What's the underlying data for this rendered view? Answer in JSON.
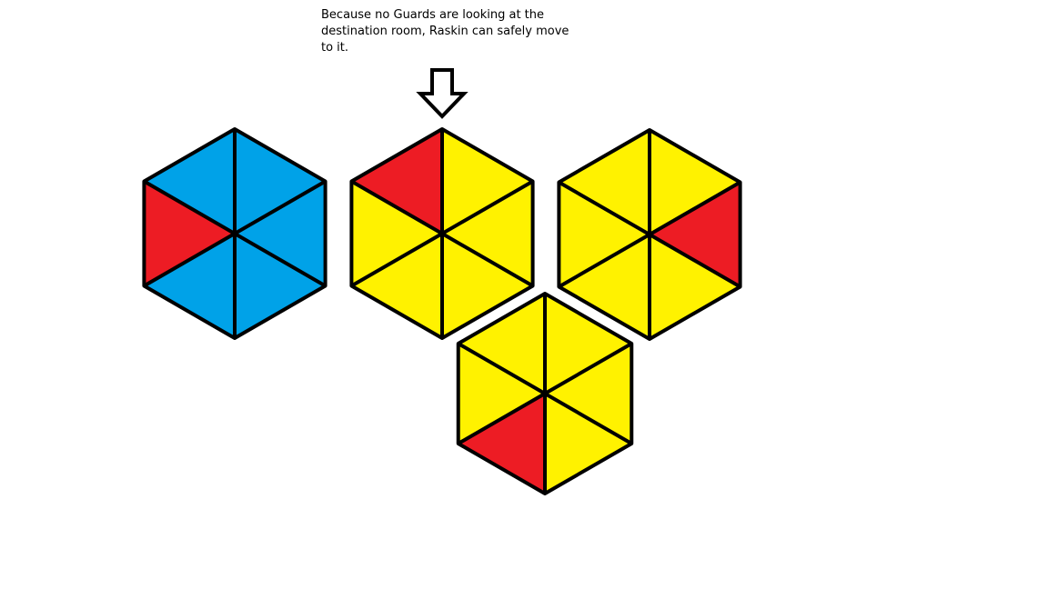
{
  "caption": "Because no Guards are looking at the destination room, Raskin can safely move to it.",
  "colors": {
    "blue": "#00A2E8",
    "red": "#ED1C24",
    "yellow": "#FFF200",
    "outline": "#000000"
  },
  "rooms": [
    {
      "label": "room-left",
      "slices": [
        "blue",
        "blue",
        "blue",
        "blue",
        "red",
        "blue"
      ]
    },
    {
      "label": "room-destination",
      "destination": true,
      "slices": [
        "yellow",
        "yellow",
        "yellow",
        "yellow",
        "yellow",
        "red"
      ]
    },
    {
      "label": "room-right",
      "slices": [
        "yellow",
        "red",
        "yellow",
        "yellow",
        "yellow",
        "yellow"
      ]
    },
    {
      "label": "room-bottom",
      "slices": [
        "yellow",
        "yellow",
        "yellow",
        "red",
        "yellow",
        "yellow"
      ]
    }
  ],
  "arrow_icon": "down-arrow-icon"
}
